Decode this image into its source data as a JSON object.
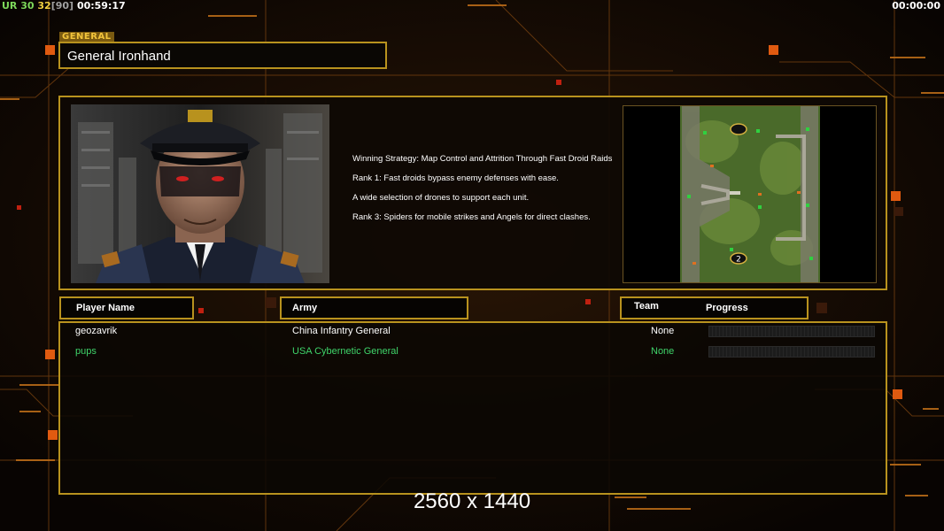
{
  "hud": {
    "ur_label": "UR",
    "fps_a": "30",
    "fps_b": "32",
    "fps_c": "[90]",
    "clock": "00:59:17",
    "timer": "00:00:00"
  },
  "general": {
    "tag": "GENERAL",
    "name": "General Ironhand",
    "strategy": [
      "Winning Strategy: Map Control and Attrition Through Fast Droid Raids",
      "Rank 1: Fast droids bypass enemy defenses with ease.",
      "A wide selection of drones to support each unit.",
      "Rank 3: Spiders for mobile strikes and Angels for direct clashes."
    ],
    "portrait_icon": "general-portrait-image",
    "minimap_icon": "map-preview-image",
    "minimap_start_label": "2"
  },
  "table": {
    "headers": {
      "player": "Player Name",
      "army": "Army",
      "team": "Team",
      "progress": "Progress"
    },
    "rows": [
      {
        "player": "geozavrik",
        "army": "China Infantry General",
        "team": "None",
        "color": "#ffffff",
        "progress": 0
      },
      {
        "player": "pups",
        "army": "USA Cybernetic General",
        "team": "None",
        "color": "#3fd46a",
        "progress": 0
      }
    ]
  },
  "resolution": "2560 x 1440",
  "colors": {
    "accent_gold": "#b8921e",
    "hud_green": "#7cd85a",
    "hud_yellow": "#f0d040",
    "hud_gray": "#a0a0a0",
    "player2": "#3fd46a"
  }
}
